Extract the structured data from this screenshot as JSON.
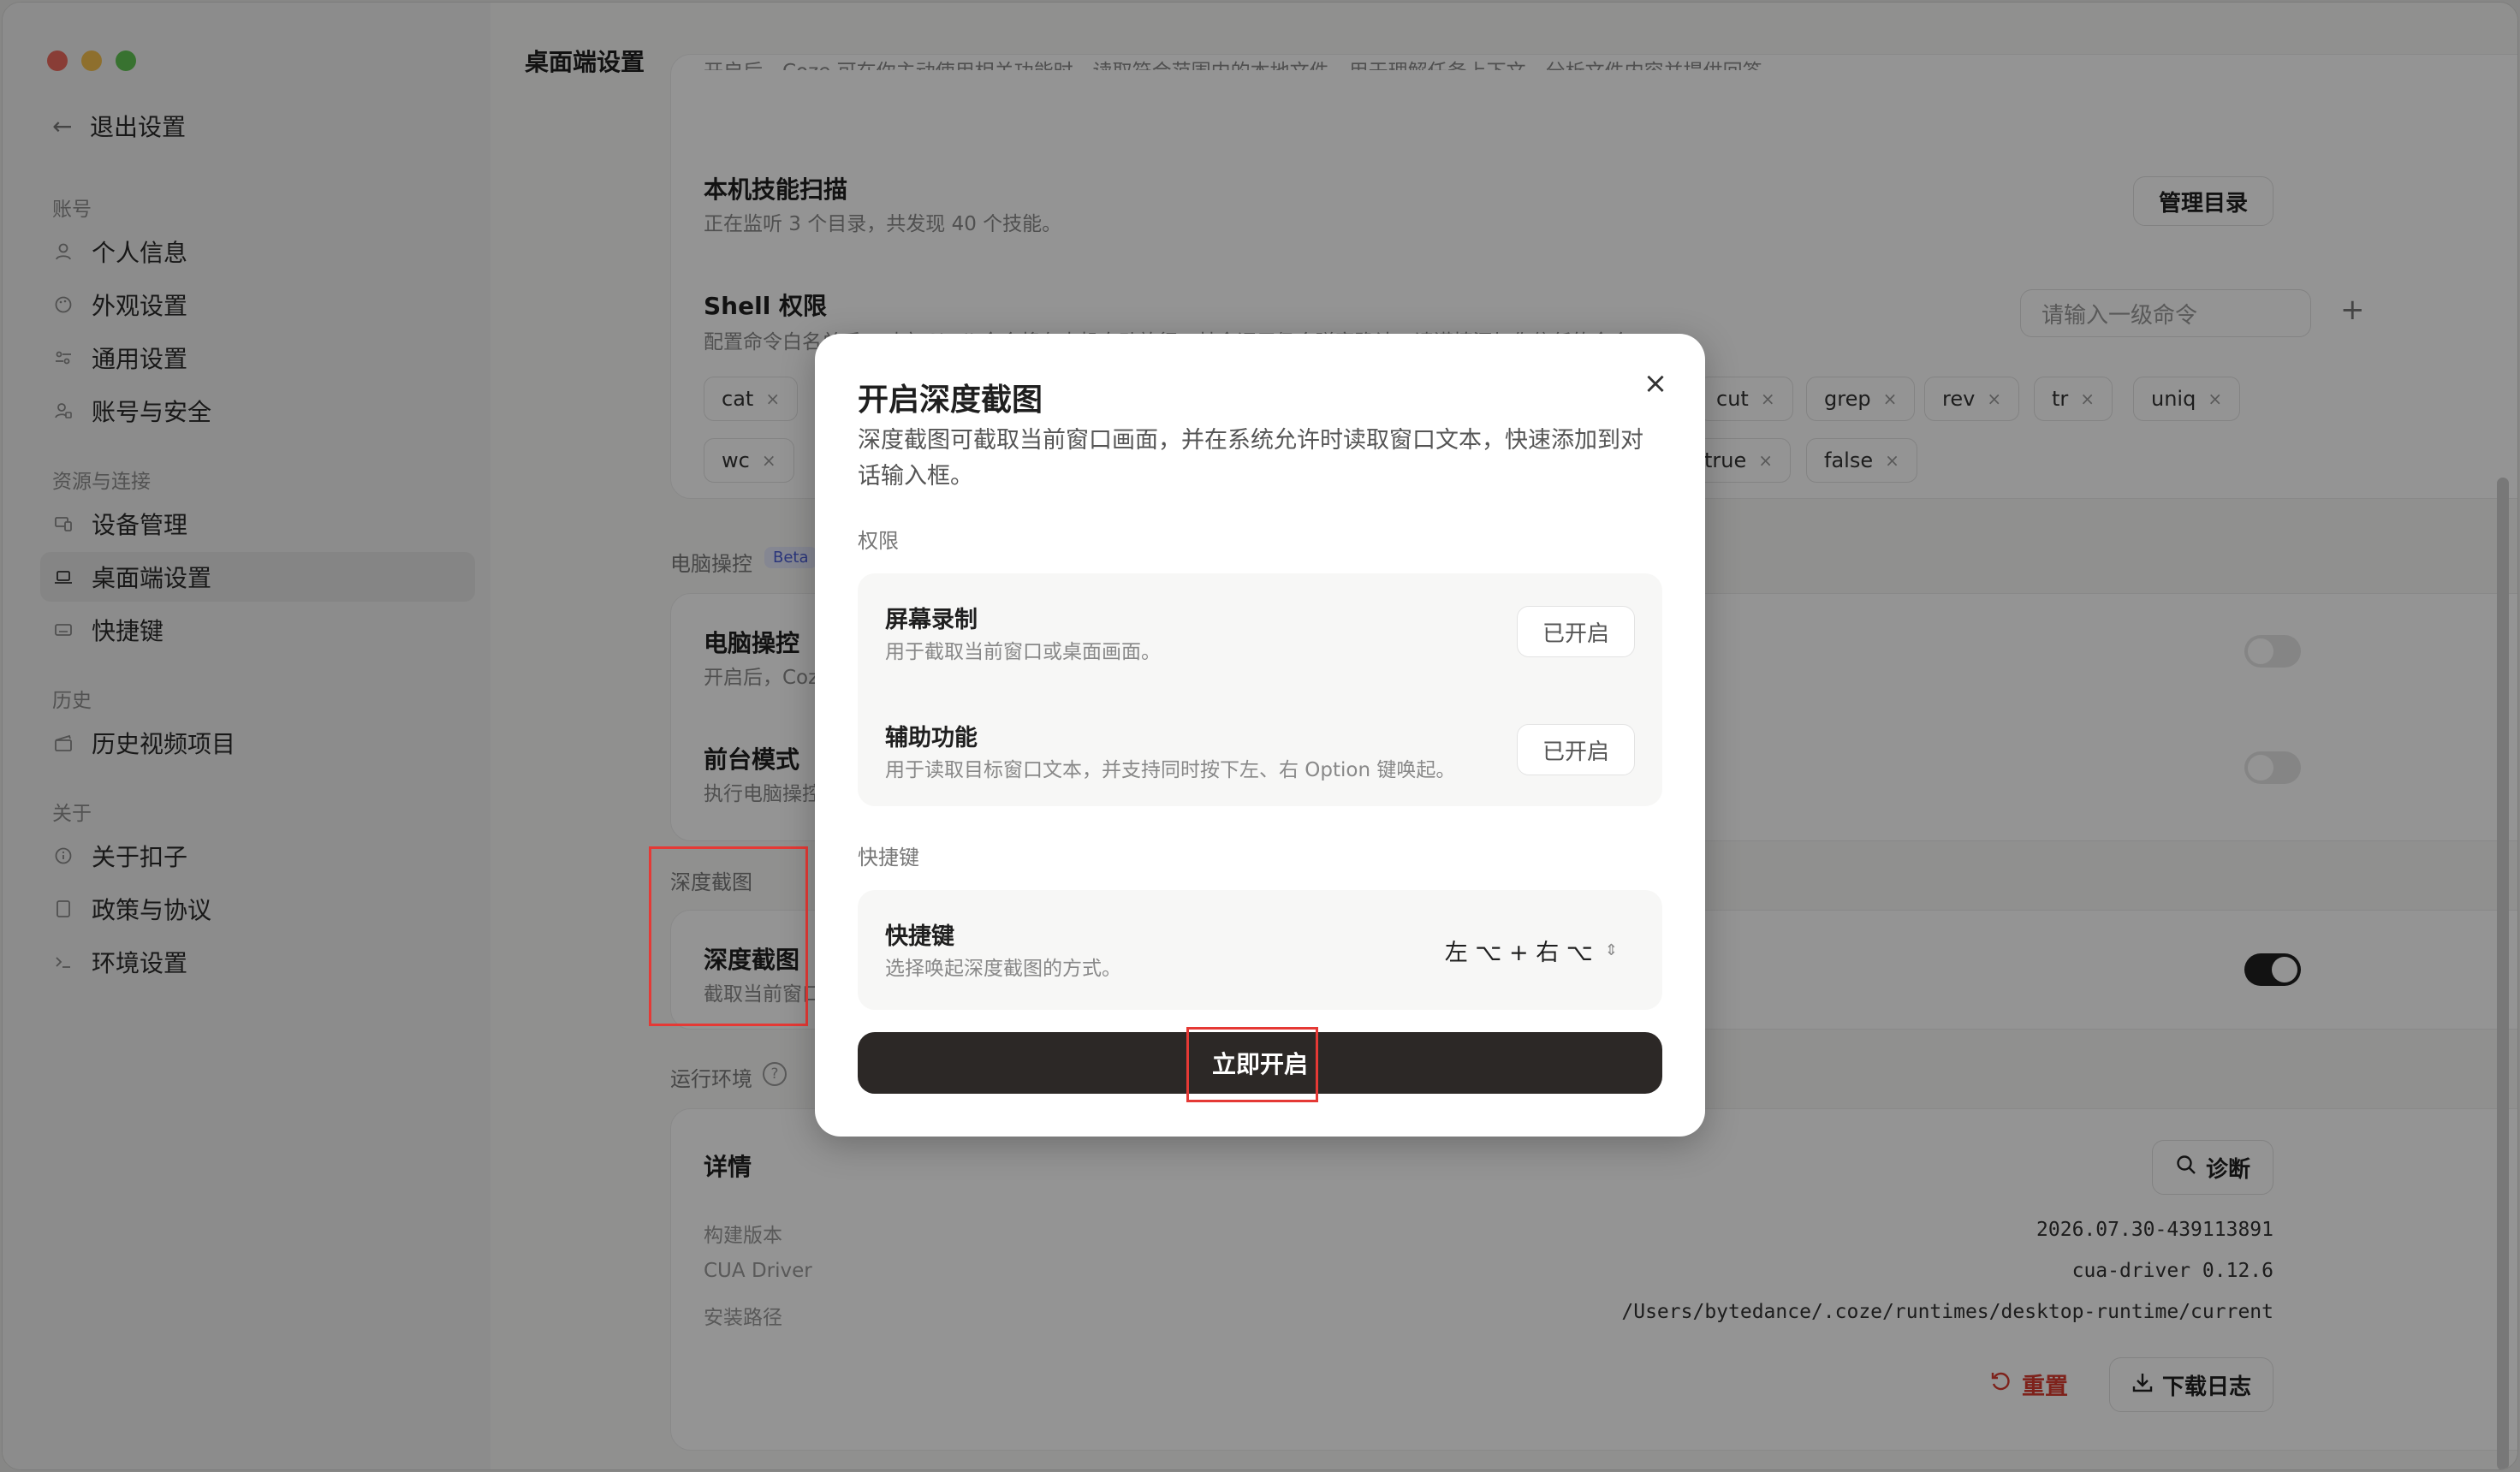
{
  "sidebar": {
    "back_label": "退出设置",
    "sections": {
      "account": "账号",
      "resources": "资源与连接",
      "history": "历史",
      "about": "关于"
    },
    "items": {
      "personal": "个人信息",
      "appearance": "外观设置",
      "general": "通用设置",
      "security": "账号与安全",
      "devices": "设备管理",
      "desktop": "桌面端设置",
      "shortcuts": "快捷键",
      "history_videos": "历史视频项目",
      "about_kouzi": "关于扣子",
      "policy": "政策与协议",
      "env": "环境设置"
    }
  },
  "main": {
    "title": "桌面端设置",
    "top_truncated": "开启后，Coze 可在你主动使用相关功能时，读取符合范围内的本地文件，用于理解任务上下文、分析文件内容并提供回答。",
    "skills": {
      "title": "本机技能扫描",
      "sub": "正在监听 3 个目录，共发现 40 个技能。",
      "button": "管理目录"
    },
    "shell": {
      "title": "Shell 权限",
      "sub": "配置命令白名单后，对应 Shell 命令将在本机自动放行，其余调用仍会弹窗确认。请谨慎添加你信任的命令。",
      "input_placeholder": "请输入一级命令",
      "add": "+",
      "tags_row1_left": [
        "cat"
      ],
      "tags_row1_right": [
        "cut",
        "grep",
        "rev",
        "tr",
        "uniq"
      ],
      "tags_row2_left": [
        "wc"
      ],
      "tags_row2_right": [
        "true",
        "false"
      ],
      "tag_remove": "×"
    },
    "computer": {
      "section": "电脑操控",
      "beta": "Beta",
      "control_title": "电脑操控",
      "control_sub": "开启后，Coze",
      "fore_title": "前台模式",
      "fore_sub": "执行电脑操控"
    },
    "deep": {
      "section": "深度截图",
      "title": "深度截图",
      "sub": "截取当前窗口"
    },
    "runtime": {
      "section": "运行环境",
      "help": "?",
      "details": "详情",
      "diagnose": "诊断",
      "build_label": "构建版本",
      "build_value": "2026.07.30-439113891",
      "cua_label": "CUA Driver",
      "cua_value": "cua-driver 0.12.6",
      "path_label": "安装路径",
      "path_value": "/Users/bytedance/.coze/runtimes/desktop-runtime/current",
      "reset": "重置",
      "download": "下载日志"
    }
  },
  "modal": {
    "title": "开启深度截图",
    "close": "×",
    "desc": "深度截图可截取当前窗口画面，并在系统允许时读取窗口文本，快速添加到对话输入框。",
    "perm_label": "权限",
    "screen_title": "屏幕录制",
    "screen_sub": "用于截取当前窗口或桌面画面。",
    "screen_status": "已开启",
    "access_title": "辅助功能",
    "access_sub": "用于读取目标窗口文本，并支持同时按下左、右 Option 键唤起。",
    "access_status": "已开启",
    "shortcut_label": "快捷键",
    "shortcut_title": "快捷键",
    "shortcut_sub": "选择唤起深度截图的方式。",
    "shortcut_value": "左 ⌥ + 右 ⌥",
    "primary": "立即开启"
  },
  "colors": {
    "highlight": "#e53935",
    "primary": "#2c2826",
    "reset": "#d93b30"
  }
}
